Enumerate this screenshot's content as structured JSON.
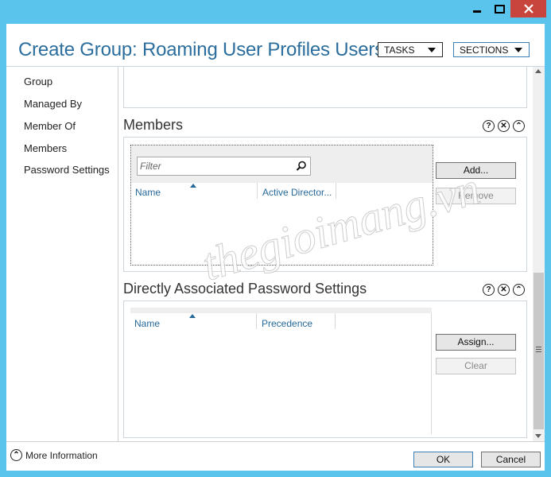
{
  "window": {
    "title": "Create Group: Roaming User Profiles Users...",
    "controls": {
      "minimize_icon": "minimize-icon",
      "maximize_icon": "maximize-icon",
      "close_icon": "close-icon"
    }
  },
  "header": {
    "tasks_label": "TASKS",
    "sections_label": "SECTIONS"
  },
  "nav": {
    "items": [
      {
        "label": "Group"
      },
      {
        "label": "Managed By"
      },
      {
        "label": "Member Of"
      },
      {
        "label": "Members"
      },
      {
        "label": "Password Settings"
      }
    ]
  },
  "members": {
    "title": "Members",
    "header_icons": [
      "?",
      "✕",
      "⌃"
    ],
    "filter_placeholder": "Filter",
    "columns": [
      "Name",
      "Active Director..."
    ],
    "add_label": "Add...",
    "remove_label": "Remove"
  },
  "password_settings": {
    "title": "Directly Associated Password Settings",
    "header_icons": [
      "?",
      "✕",
      "⌃"
    ],
    "columns": [
      "Name",
      "Precedence"
    ],
    "assign_label": "Assign...",
    "clear_label": "Clear"
  },
  "footer": {
    "more_info_label": "More Information",
    "ok_label": "OK",
    "cancel_label": "Cancel"
  },
  "watermark": "thegioimang.vn",
  "colors": {
    "frame": "#5bc4ec",
    "title": "#2b6e9e",
    "close": "#c7453c",
    "column_header": "#26699b"
  }
}
